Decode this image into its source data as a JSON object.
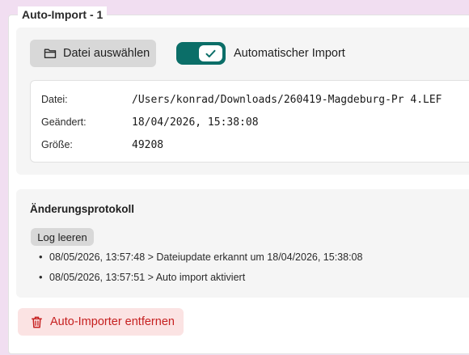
{
  "section": {
    "legend": "Auto-Import - 1"
  },
  "file_select": {
    "button_label": "Datei auswählen",
    "icon": "folder-icon"
  },
  "auto_import_toggle": {
    "label": "Automatischer Import",
    "checked": true,
    "accent_color": "#0b6e68"
  },
  "file_info": {
    "rows": [
      {
        "key": "Datei:",
        "value": "/Users/konrad/Downloads/260419-Magdeburg-Pr 4.LEF"
      },
      {
        "key": "Geändert:",
        "value": "18/04/2026, 15:38:08"
      },
      {
        "key": "Größe:",
        "value": "49208"
      }
    ]
  },
  "changelog": {
    "title": "Änderungsprotokoll",
    "clear_button_label": "Log leeren",
    "entries": [
      "08/05/2026, 13:57:48 > Dateiupdate erkannt um 18/04/2026, 15:38:08",
      "08/05/2026, 13:57:51 > Auto import aktiviert"
    ]
  },
  "remove_button": {
    "label": "Auto-Importer entfernen",
    "icon": "trash-icon",
    "color": "#c62020"
  }
}
